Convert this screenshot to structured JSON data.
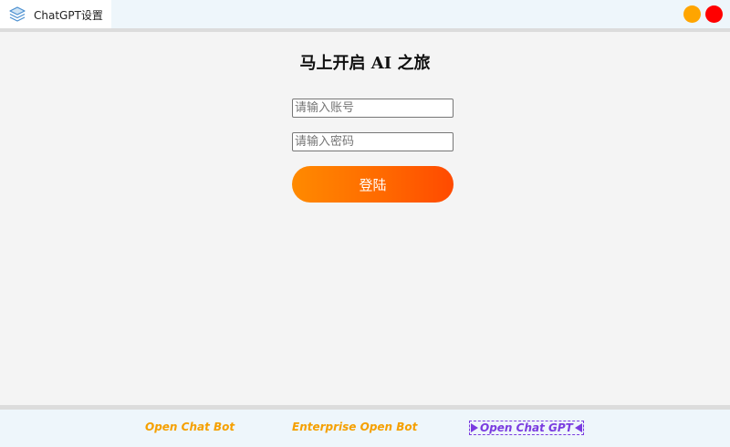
{
  "window": {
    "title": "ChatGPT设置",
    "tab_icon": "layers-icon",
    "minimize_color": "#ffa500",
    "close_color": "#ff0000"
  },
  "login": {
    "heading": "马上开启 AI 之旅",
    "account_placeholder": "请输入账号",
    "account_value": "",
    "password_placeholder": "请输入密码",
    "password_value": "",
    "submit_label": "登陆",
    "accent_color": "#ff7a00"
  },
  "footer": {
    "links": [
      {
        "label": "Open Chat Bot",
        "color": "#f5a000"
      },
      {
        "label": "Enterprise Open Bot",
        "color": "#f5a000"
      },
      {
        "label": "Open Chat GPT",
        "color": "#7a3ce0"
      }
    ]
  }
}
